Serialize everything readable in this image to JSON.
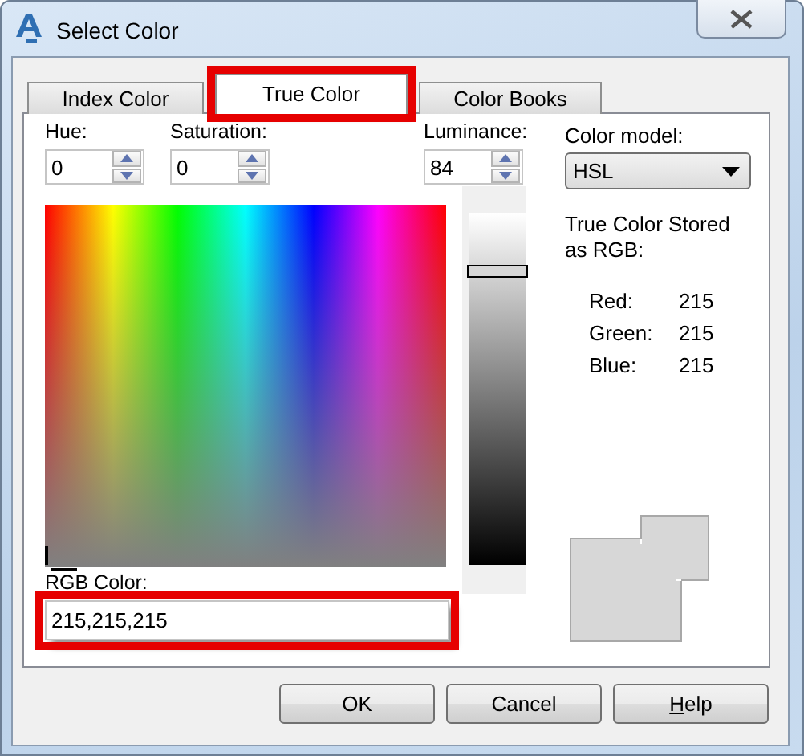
{
  "window": {
    "title": "Select Color"
  },
  "tabs": [
    {
      "label": "Index Color",
      "selected": false,
      "highlighted": false
    },
    {
      "label": "True Color",
      "selected": true,
      "highlighted": true
    },
    {
      "label": "Color Books",
      "selected": false,
      "highlighted": false
    }
  ],
  "hsl_fields": [
    {
      "label": "Hue:",
      "value": "0"
    },
    {
      "label": "Saturation:",
      "value": "0"
    },
    {
      "label": "Luminance:",
      "value": "84"
    }
  ],
  "luminance_slider": {
    "level": 0.84
  },
  "rgb_color": {
    "label": "RGB Color:",
    "value": "215,215,215",
    "highlighted": true
  },
  "color_model": {
    "label": "Color model:",
    "value": "HSL"
  },
  "stored": {
    "caption": "True Color Stored as RGB:",
    "rows": [
      {
        "label": "Red:",
        "value": "215"
      },
      {
        "label": "Green:",
        "value": "215"
      },
      {
        "label": "Blue:",
        "value": "215"
      }
    ]
  },
  "buttons": [
    {
      "label": "OK",
      "mnemonic": false
    },
    {
      "label": "Cancel",
      "mnemonic": false
    },
    {
      "label": "Help",
      "mnemonic": true
    }
  ]
}
